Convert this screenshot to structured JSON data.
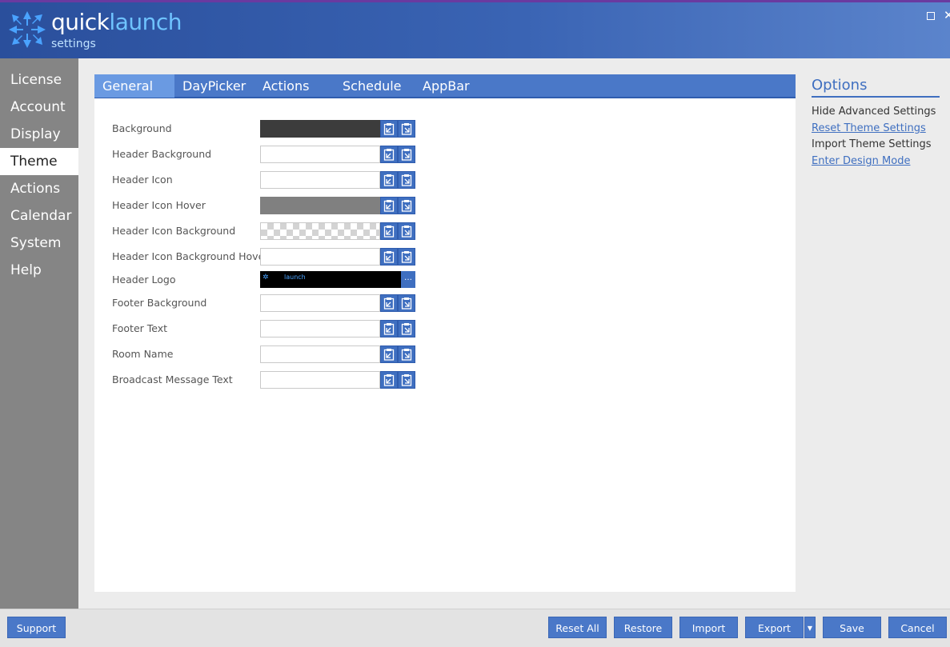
{
  "header": {
    "logo_word1": "quick",
    "logo_word2": "launch",
    "logo_sub": "settings"
  },
  "sidebar": {
    "items": [
      {
        "label": "License"
      },
      {
        "label": "Account"
      },
      {
        "label": "Display"
      },
      {
        "label": "Theme",
        "active": true
      },
      {
        "label": "Actions"
      },
      {
        "label": "Calendar"
      },
      {
        "label": "System"
      },
      {
        "label": "Help"
      }
    ]
  },
  "tabs": [
    {
      "label": "General",
      "active": true
    },
    {
      "label": "DayPicker"
    },
    {
      "label": "Actions"
    },
    {
      "label": "Schedule"
    },
    {
      "label": "AppBar"
    }
  ],
  "settings": [
    {
      "label": "Background",
      "swatch": "dark"
    },
    {
      "label": "Header Background",
      "swatch": "white"
    },
    {
      "label": "Header Icon",
      "swatch": "white"
    },
    {
      "label": "Header Icon Hover",
      "swatch": "gray"
    },
    {
      "label": "Header Icon Background",
      "swatch": "checker"
    },
    {
      "label": "Header Icon Background Hover",
      "swatch": "white"
    },
    {
      "label": "Header Logo",
      "swatch": "logo",
      "logo_text": "launch"
    },
    {
      "label": "Footer Background",
      "swatch": "white"
    },
    {
      "label": "Footer Text",
      "swatch": "white"
    },
    {
      "label": "Room Name",
      "swatch": "white"
    },
    {
      "label": "Broadcast Message Text",
      "swatch": "white"
    }
  ],
  "options": {
    "title": "Options",
    "items": [
      {
        "label": "Hide Advanced Settings",
        "link": false
      },
      {
        "label": "Reset Theme Settings",
        "link": true
      },
      {
        "label": "Import Theme Settings",
        "link": false
      },
      {
        "label": "Enter Design Mode",
        "link": true
      }
    ]
  },
  "footer": {
    "support": "Support",
    "reset_all": "Reset All",
    "restore": "Restore",
    "import": "Import",
    "export": "Export",
    "save": "Save",
    "cancel": "Cancel"
  },
  "colors": {
    "accent": "#4a78c8",
    "header_dark": "#2a4f9c",
    "sidebar": "#858585"
  }
}
